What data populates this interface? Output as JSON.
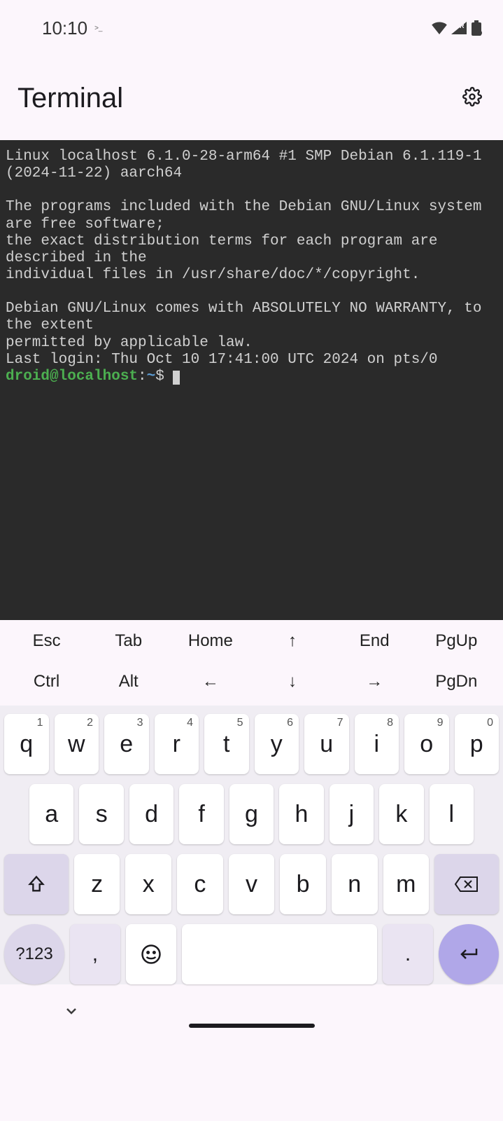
{
  "status": {
    "time": "10:10",
    "extra": ">_",
    "roaming": "R"
  },
  "app": {
    "title": "Terminal"
  },
  "terminal": {
    "line1": "Linux localhost 6.1.0-28-arm64 #1 SMP Debian 6.1.119-1 (2024-11-22) aarch64",
    "line2": "",
    "line3": "The programs included with the Debian GNU/Linux system are free software;",
    "line4": "the exact distribution terms for each program are described in the",
    "line5": "individual files in /usr/share/doc/*/copyright.",
    "line6": "",
    "line7": "Debian GNU/Linux comes with ABSOLUTELY NO WARRANTY, to the extent",
    "line8": "permitted by applicable law.",
    "line9": "Last login: Thu Oct 10 17:41:00 UTC 2024 on pts/0",
    "prompt_user": "droid@localhost",
    "prompt_sep": ":",
    "prompt_path": "~",
    "prompt_dollar": "$ "
  },
  "navkeys": {
    "row1": [
      "Esc",
      "Tab",
      "Home",
      "↑",
      "End",
      "PgUp"
    ],
    "row2": [
      "Ctrl",
      "Alt",
      "←",
      "↓",
      "→",
      "PgDn"
    ]
  },
  "keyboard": {
    "row1": [
      {
        "k": "q",
        "d": "1"
      },
      {
        "k": "w",
        "d": "2"
      },
      {
        "k": "e",
        "d": "3"
      },
      {
        "k": "r",
        "d": "4"
      },
      {
        "k": "t",
        "d": "5"
      },
      {
        "k": "y",
        "d": "6"
      },
      {
        "k": "u",
        "d": "7"
      },
      {
        "k": "i",
        "d": "8"
      },
      {
        "k": "o",
        "d": "9"
      },
      {
        "k": "p",
        "d": "0"
      }
    ],
    "row2": [
      {
        "k": "a"
      },
      {
        "k": "s"
      },
      {
        "k": "d"
      },
      {
        "k": "f"
      },
      {
        "k": "g"
      },
      {
        "k": "h"
      },
      {
        "k": "j"
      },
      {
        "k": "k"
      },
      {
        "k": "l"
      }
    ],
    "row3": [
      {
        "k": "z"
      },
      {
        "k": "x"
      },
      {
        "k": "c"
      },
      {
        "k": "v"
      },
      {
        "k": "b"
      },
      {
        "k": "n"
      },
      {
        "k": "m"
      }
    ],
    "symkey": "?123",
    "comma": ",",
    "period": "."
  }
}
